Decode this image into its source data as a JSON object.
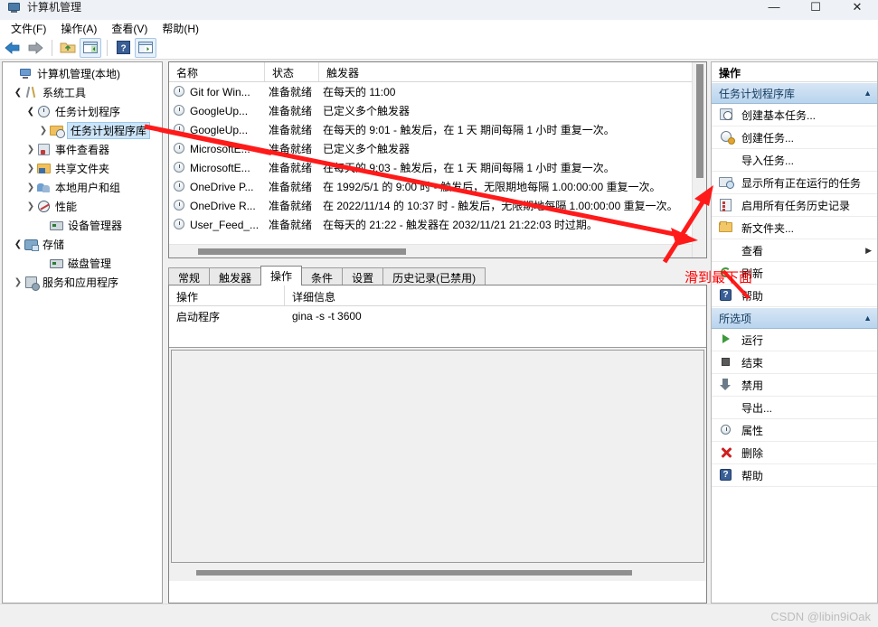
{
  "window": {
    "title": "计算机管理",
    "icon": "computer-management-icon",
    "minimize": "—",
    "maximize": "☐",
    "close": "✕"
  },
  "menubar": {
    "items": [
      {
        "label": "文件(F)"
      },
      {
        "label": "操作(A)"
      },
      {
        "label": "查看(V)"
      },
      {
        "label": "帮助(H)"
      }
    ]
  },
  "toolbar": {
    "buttons": [
      {
        "name": "back-arrow-icon",
        "label": ""
      },
      {
        "name": "forward-arrow-icon",
        "label": ""
      },
      {
        "name": "up-folder-icon",
        "label": ""
      },
      {
        "name": "show-hide-console-tree-icon",
        "label": ""
      },
      {
        "name": "help-icon",
        "label": ""
      },
      {
        "name": "show-hide-action-pane-icon",
        "label": ""
      }
    ]
  },
  "tree": {
    "nodes": [
      {
        "label": "计算机管理(本地)",
        "icon": "computer-icon",
        "indent": 0,
        "twist": "",
        "selected": false
      },
      {
        "label": "系统工具",
        "icon": "system-tools-icon",
        "indent": 1,
        "twist": "open",
        "selected": false
      },
      {
        "label": "任务计划程序",
        "icon": "task-scheduler-icon",
        "indent": 2,
        "twist": "open",
        "selected": false
      },
      {
        "label": "任务计划程序库",
        "icon": "task-scheduler-library-icon",
        "indent": 3,
        "twist": "closed",
        "selected": true
      },
      {
        "label": "事件查看器",
        "icon": "event-viewer-icon",
        "indent": 2,
        "twist": "closed",
        "selected": false
      },
      {
        "label": "共享文件夹",
        "icon": "shared-folders-icon",
        "indent": 2,
        "twist": "closed",
        "selected": false
      },
      {
        "label": "本地用户和组",
        "icon": "local-users-groups-icon",
        "indent": 2,
        "twist": "closed",
        "selected": false
      },
      {
        "label": "性能",
        "icon": "performance-icon",
        "indent": 2,
        "twist": "closed",
        "selected": false
      },
      {
        "label": "设备管理器",
        "icon": "device-manager-icon",
        "indent": 2,
        "twist": "",
        "selected": false
      },
      {
        "label": "存储",
        "icon": "storage-icon",
        "indent": 1,
        "twist": "open",
        "selected": false
      },
      {
        "label": "磁盘管理",
        "icon": "disk-management-icon",
        "indent": 2,
        "twist": "",
        "selected": false
      },
      {
        "label": "服务和应用程序",
        "icon": "services-applications-icon",
        "indent": 1,
        "twist": "closed",
        "selected": false
      }
    ]
  },
  "task_list": {
    "columns": [
      "名称",
      "状态",
      "触发器"
    ],
    "rows": [
      {
        "name": "Git for Win...",
        "status": "准备就绪",
        "trigger": "在每天的 11:00"
      },
      {
        "name": "GoogleUp...",
        "status": "准备就绪",
        "trigger": "已定义多个触发器"
      },
      {
        "name": "GoogleUp...",
        "status": "准备就绪",
        "trigger": "在每天的 9:01 - 触发后，在 1 天 期间每隔 1 小时 重复一次。"
      },
      {
        "name": "MicrosoftE...",
        "status": "准备就绪",
        "trigger": "已定义多个触发器"
      },
      {
        "name": "MicrosoftE...",
        "status": "准备就绪",
        "trigger": "在每天的 9:03 - 触发后，在 1 天 期间每隔 1 小时 重复一次。"
      },
      {
        "name": "OneDrive P...",
        "status": "准备就绪",
        "trigger": "在 1992/5/1 的 9:00 时 - 触发后，无限期地每隔 1.00:00:00 重复一次。"
      },
      {
        "name": "OneDrive R...",
        "status": "准备就绪",
        "trigger": "在 2022/11/14 的 10:37 时 - 触发后，无限期地每隔 1.00:00:00 重复一次。"
      },
      {
        "name": "User_Feed_...",
        "status": "准备就绪",
        "trigger": "在每天的 21:22 - 触发器在 2032/11/21 21:22:03 时过期。"
      }
    ]
  },
  "tabs": [
    {
      "label": "常规",
      "active": false
    },
    {
      "label": "触发器",
      "active": false
    },
    {
      "label": "操作",
      "active": true
    },
    {
      "label": "条件",
      "active": false
    },
    {
      "label": "设置",
      "active": false
    },
    {
      "label": "历史记录(已禁用)",
      "active": false
    }
  ],
  "detail_table": {
    "columns": [
      "操作",
      "详细信息"
    ],
    "rows": [
      {
        "operation": "启动程序",
        "details": "gina -s -t 3600"
      }
    ]
  },
  "actions_pane": {
    "title": "操作",
    "groups": [
      {
        "name": "任务计划程序库",
        "collapse_glyph": "▲",
        "items": [
          {
            "label": "创建基本任务...",
            "icon": "create-basic-task-icon",
            "submenu": false
          },
          {
            "label": "创建任务...",
            "icon": "create-task-icon",
            "submenu": false
          },
          {
            "label": "导入任务...",
            "icon": "",
            "submenu": false
          },
          {
            "label": "显示所有正在运行的任务",
            "icon": "show-running-tasks-icon",
            "submenu": false
          },
          {
            "label": "启用所有任务历史记录",
            "icon": "enable-task-history-icon",
            "submenu": false
          },
          {
            "label": "新文件夹...",
            "icon": "new-folder-icon",
            "submenu": false
          },
          {
            "label": "查看",
            "icon": "",
            "submenu": true
          },
          {
            "label": "刷新",
            "icon": "refresh-icon",
            "submenu": false
          },
          {
            "label": "帮助",
            "icon": "help-icon",
            "submenu": false
          }
        ]
      },
      {
        "name": "所选项",
        "collapse_glyph": "▲",
        "items": [
          {
            "label": "运行",
            "icon": "run-icon",
            "submenu": false
          },
          {
            "label": "结束",
            "icon": "end-icon",
            "submenu": false
          },
          {
            "label": "禁用",
            "icon": "disable-icon",
            "submenu": false
          },
          {
            "label": "导出...",
            "icon": "",
            "submenu": false
          },
          {
            "label": "属性",
            "icon": "properties-icon",
            "submenu": false
          },
          {
            "label": "删除",
            "icon": "delete-icon",
            "submenu": false
          },
          {
            "label": "帮助",
            "icon": "help-icon",
            "submenu": false
          }
        ]
      }
    ],
    "submenu_glyph": "▶"
  },
  "annotations": {
    "note_text": "滑到最下面",
    "color": "#ff0000"
  },
  "watermark": {
    "text": "CSDN @libin9iOak"
  }
}
